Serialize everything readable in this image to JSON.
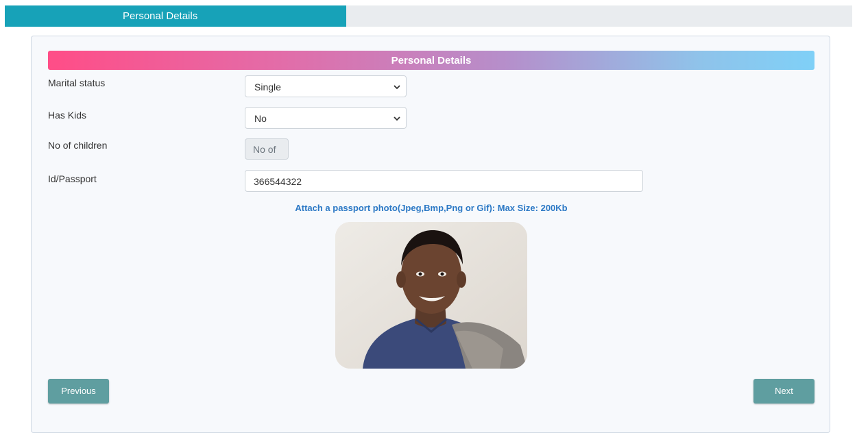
{
  "tab": {
    "label": "Personal Details"
  },
  "section": {
    "title": "Personal Details"
  },
  "fields": {
    "marital_status": {
      "label": "Marital status",
      "value": "Single"
    },
    "has_kids": {
      "label": "Has Kids",
      "value": "No"
    },
    "no_of_children": {
      "label": "No of children",
      "placeholder": "No of"
    },
    "id_passport": {
      "label": "Id/Passport",
      "value": "366544322"
    }
  },
  "attachment": {
    "label": "Attach a passport photo(Jpeg,Bmp,Png or Gif): Max Size: 200Kb"
  },
  "buttons": {
    "previous": "Previous",
    "next": "Next"
  },
  "colors": {
    "tab_active": "#17a2b8",
    "button": "#5f9ea0",
    "attach_text": "#2b78c5"
  }
}
